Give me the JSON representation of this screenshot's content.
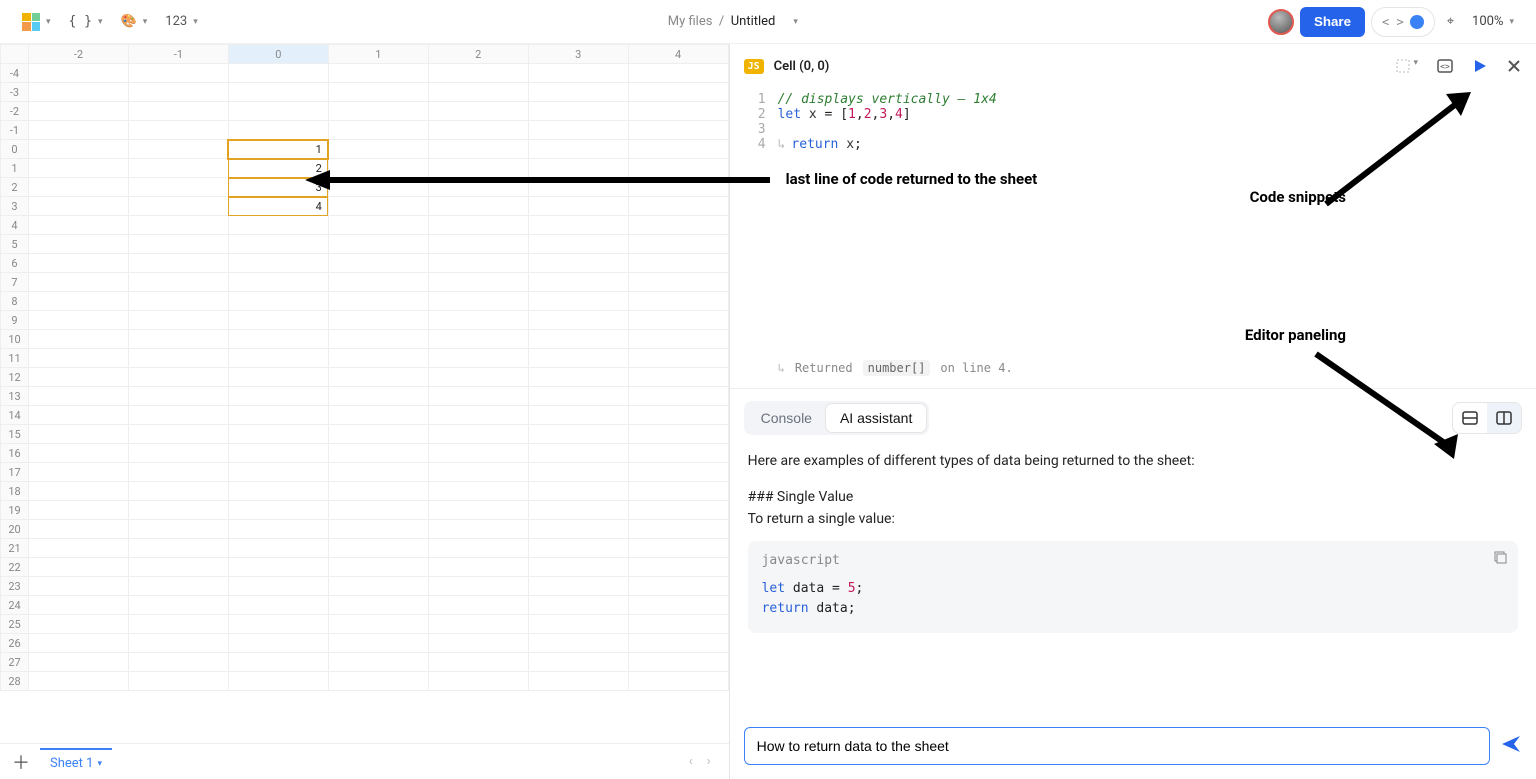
{
  "toolbar": {
    "format_number_label": "123",
    "breadcrumb_root": "My files",
    "breadcrumb_current": "Untitled",
    "share_label": "Share",
    "zoom_label": "100%"
  },
  "sheet": {
    "column_headers": [
      "-2",
      "-1",
      "0",
      "1",
      "2",
      "3",
      "4"
    ],
    "row_headers": [
      "-4",
      "-3",
      "-2",
      "-1",
      "0",
      "1",
      "2",
      "3",
      "4",
      "5",
      "6",
      "7",
      "8",
      "9",
      "10",
      "11",
      "12",
      "13",
      "14",
      "15",
      "16",
      "17",
      "18",
      "19",
      "20",
      "21",
      "22",
      "23",
      "24",
      "25",
      "26",
      "27",
      "28"
    ],
    "selected_col_index": 2,
    "active_cell": {
      "row": 4,
      "col": 2
    },
    "spill_values": [
      "1",
      "2",
      "3",
      "4"
    ],
    "tab_name": "Sheet 1"
  },
  "code": {
    "badge": "JS",
    "title": "Cell (0, 0)",
    "lines": {
      "l1_comment": "// displays vertically — 1x4",
      "l2_pre": "let ",
      "l2_id": "x",
      "l2_mid": " = [",
      "l2_n1": "1",
      "l2_n2": "2",
      "l2_n3": "3",
      "l2_n4": "4",
      "l2_end": "]",
      "l4_pre": "return ",
      "l4_id": "x",
      "l4_end": ";"
    },
    "gutters": [
      "1",
      "2",
      "3",
      "4"
    ],
    "return_status_pre": "Returned",
    "return_status_type": "number[]",
    "return_status_post": "on line 4."
  },
  "console": {
    "tab_console": "Console",
    "tab_ai": "AI assistant",
    "ai_intro": "Here are examples of different types of data being returned to the sheet:",
    "ai_h1": "### Single Value",
    "ai_h1_sub": "To return a single value:",
    "ai_code_lang": "javascript",
    "ai_code_body": "let data = 5;\nreturn data;",
    "input_value": "How to return data to the sheet"
  },
  "annotations": {
    "a1": "last line of code returned to the sheet",
    "a2": "Code snippets",
    "a3": "Editor paneling"
  }
}
